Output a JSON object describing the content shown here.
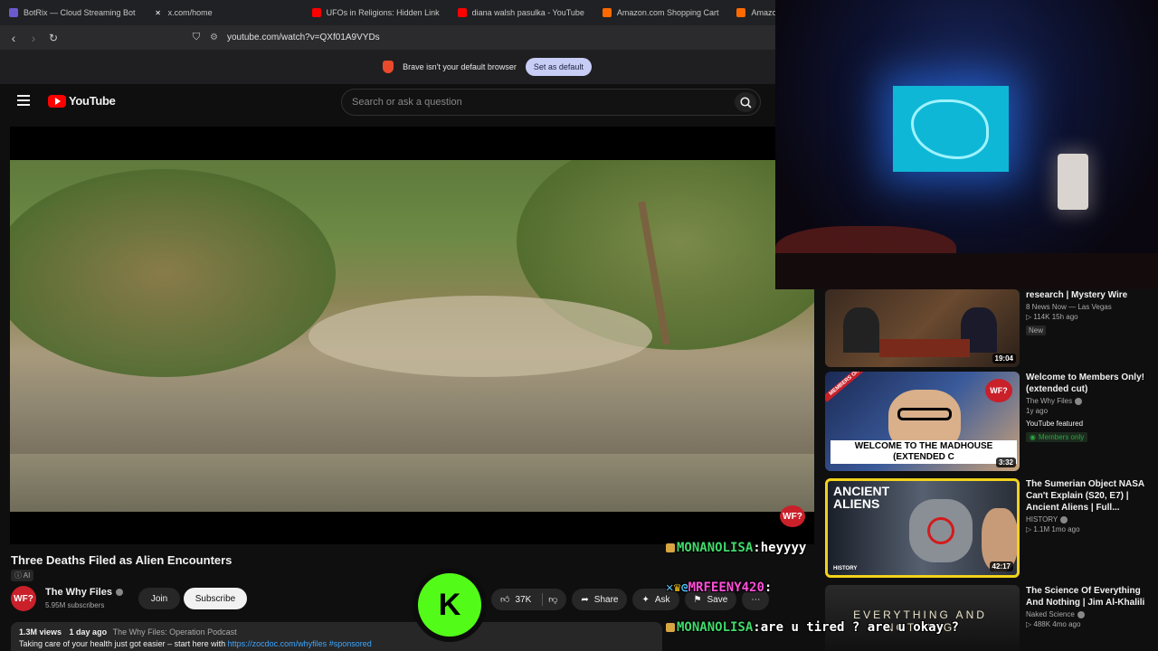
{
  "browser": {
    "tabs": [
      {
        "label": "BotRix — Cloud Streaming Bot",
        "icon": "botrix-icon",
        "color": "#6a5acd"
      },
      {
        "label": "x.com/home",
        "icon": "x-icon",
        "color": "#000000"
      },
      {
        "label": "UFOs in Religions: Hidden Link",
        "icon": "youtube-icon",
        "color": "#ff0000"
      },
      {
        "label": "diana walsh pasulka - YouTube",
        "icon": "youtube-icon",
        "color": "#ff0000"
      },
      {
        "label": "Amazon.com Shopping Cart",
        "icon": "amazon-icon",
        "color": "#ff6a00"
      },
      {
        "label": "Amazon.co",
        "icon": "amazon-icon",
        "color": "#ff6a00"
      }
    ],
    "url": "youtube.com/watch?v=QXf01A9VYDs",
    "infobar": {
      "message": "Brave isn't your default browser",
      "button": "Set as default"
    }
  },
  "youtube": {
    "logo": "YouTube",
    "search_placeholder": "Search or ask a question"
  },
  "video": {
    "title": "Three Deaths Filed as Alien Encounters",
    "ai_tag": "AI",
    "watermark": "WF?",
    "channel": {
      "avatar": "WF?",
      "name": "The Why Files",
      "subscribers": "5.95M subscribers"
    },
    "join_label": "Join",
    "subscribe_label": "Subscribe",
    "likes": "37K",
    "share_label": "Share",
    "ask_label": "Ask",
    "save_label": "Save",
    "description": {
      "views": "1.3M views",
      "age": "1 day ago",
      "series": "The Why Files: Operation Podcast",
      "line2_text": "Taking care of your health just got easier – start here with",
      "link": "https://zocdoc.com/whyfiles",
      "tag": "#sponsored"
    }
  },
  "kick_logo": "K",
  "recommendations": [
    {
      "title": "research | Mystery Wire",
      "channel": "8 News Now — Las Vegas",
      "meta": "114K  15h ago",
      "badge": "New",
      "duration": "19:04"
    },
    {
      "title": "Welcome to Members Only! (extended cut)",
      "channel": "The Why Files",
      "meta": "1y ago",
      "featured": "YouTube featured",
      "members": "Members only",
      "thumb_text": "WELCOME TO THE MADHOUSE (EXTENDED C",
      "thumb_badge": "WF?",
      "corner": "MEMBERS ONLY",
      "duration": "3:32"
    },
    {
      "title": "The Sumerian Object NASA Can't Explain (S20, E7) | Ancient Aliens | Full...",
      "channel": "HISTORY",
      "meta": "1.1M  1mo ago",
      "thumb_text": "ANCIENT ALIENS",
      "thumb_badge": "HISTORY",
      "duration": "42:17"
    },
    {
      "title": "The Science Of Everything And Nothing | Jim Al-Khalili",
      "channel": "Naked Science",
      "meta": "488K  4mo ago",
      "thumb_text": "EVERYTHING AND NOTHING"
    }
  ],
  "chat": [
    {
      "user": "MONANOLISA",
      "message": "heyyyy",
      "user_color": "#42d96b"
    },
    {
      "user": "MRFEENY420",
      "message": "",
      "user_color": "#ff4fd8"
    },
    {
      "user": "MONANOLISA",
      "message": "are u tired ? are u okay ?",
      "user_color": "#42d96b"
    }
  ]
}
